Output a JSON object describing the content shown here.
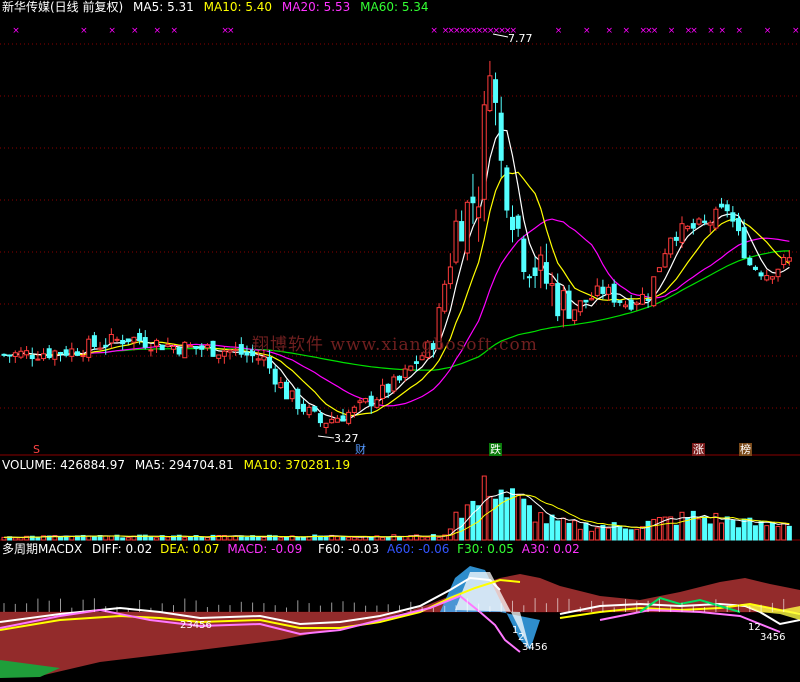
{
  "header": {
    "stock": "新华传媒(日线 前复权)",
    "ma5": "MA5: 5.31",
    "ma10": "MA10: 5.40",
    "ma20": "MA20: 5.53",
    "ma60": "MA60: 5.34"
  },
  "watermark": "翔博软件 www.xiangbosoft.com",
  "price_labels": {
    "high": "7.77",
    "low": "3.27"
  },
  "events": {
    "s": "S",
    "cai": "财",
    "die": "跌",
    "zhang": "涨",
    "bang": "榜"
  },
  "volume_header": {
    "volume": "VOLUME: 426884.97",
    "ma5": "MA5: 294704.81",
    "ma10": "MA10: 370281.19"
  },
  "macd_header": {
    "name": "多周期MACDX",
    "diff": "DIFF: 0.02",
    "dea": "DEA: 0.07",
    "macd": "MACD: -0.09",
    "f60": "F60: -0.03",
    "a60": "A60: -0.06",
    "f30": "F30: 0.05",
    "a30": "A30: 0.02"
  },
  "macd_wave_labels": {
    "left": "23456",
    "mid_a": "1",
    "mid_b": "2",
    "mid_c": "3456",
    "right_a": "12",
    "right_b": "3456"
  },
  "colors": {
    "up": "#ff3b3b",
    "down": "#54ffff",
    "ma5": "#ffffff",
    "ma10": "#ffff00",
    "ma20": "#ff00ff",
    "ma60": "#00e000",
    "grid": "#8a0000",
    "text": "#ffffff",
    "cross": "#ff00ff"
  },
  "chart_data": [
    {
      "type": "candlestick",
      "title": "新华传媒(日线 前复权)",
      "ylim": [
        3.0,
        8.0
      ],
      "grid": true,
      "annotations": [
        {
          "label": "7.77",
          "value": 7.77,
          "kind": "high"
        },
        {
          "label": "3.27",
          "value": 3.27,
          "kind": "low"
        }
      ],
      "series": [
        {
          "name": "MA5",
          "last": 5.31
        },
        {
          "name": "MA10",
          "last": 5.4
        },
        {
          "name": "MA20",
          "last": 5.53
        },
        {
          "name": "MA60",
          "last": 5.34
        }
      ],
      "anchors": [
        [
          0,
          4.1
        ],
        [
          12,
          4.15
        ],
        [
          22,
          4.3
        ],
        [
          30,
          4.2
        ],
        [
          40,
          4.15
        ],
        [
          46,
          4.05
        ],
        [
          50,
          3.65
        ],
        [
          56,
          3.32
        ],
        [
          62,
          3.45
        ],
        [
          70,
          3.8
        ],
        [
          76,
          4.25
        ],
        [
          80,
          5.6
        ],
        [
          84,
          6.0
        ],
        [
          86,
          7.6
        ],
        [
          88,
          6.3
        ],
        [
          92,
          5.3
        ],
        [
          96,
          4.95
        ],
        [
          100,
          4.6
        ],
        [
          106,
          4.85
        ],
        [
          110,
          4.7
        ],
        [
          114,
          4.8
        ],
        [
          118,
          5.5
        ],
        [
          124,
          5.6
        ],
        [
          128,
          5.8
        ],
        [
          132,
          5.15
        ],
        [
          135,
          5.05
        ],
        [
          139,
          5.2
        ]
      ]
    },
    {
      "type": "bar",
      "title": "VOLUME",
      "series": [
        {
          "name": "VOLUME",
          "last": 426884.97
        },
        {
          "name": "MA5",
          "last": 294704.81
        },
        {
          "name": "MA10",
          "last": 370281.19
        }
      ],
      "anchors": [
        [
          0,
          0.05
        ],
        [
          78,
          0.06
        ],
        [
          80,
          0.45
        ],
        [
          84,
          0.55
        ],
        [
          86,
          0.9
        ],
        [
          88,
          0.75
        ],
        [
          92,
          0.5
        ],
        [
          96,
          0.3
        ],
        [
          100,
          0.22
        ],
        [
          110,
          0.2
        ],
        [
          116,
          0.28
        ],
        [
          122,
          0.35
        ],
        [
          128,
          0.3
        ],
        [
          134,
          0.22
        ],
        [
          139,
          0.28
        ]
      ]
    },
    {
      "type": "area",
      "title": "多周期MACDX",
      "series": [
        {
          "name": "DIFF",
          "last": 0.02
        },
        {
          "name": "DEA",
          "last": 0.07
        },
        {
          "name": "MACD",
          "last": -0.09
        },
        {
          "name": "F60",
          "last": -0.03
        },
        {
          "name": "A60",
          "last": -0.06
        },
        {
          "name": "F30",
          "last": 0.05
        },
        {
          "name": "A30",
          "last": 0.02
        }
      ]
    }
  ]
}
